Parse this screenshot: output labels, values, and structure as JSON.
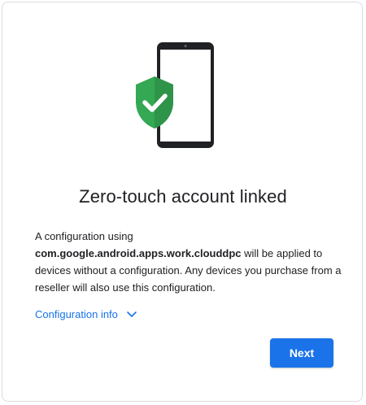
{
  "dialog": {
    "title": "Zero-touch account linked",
    "description_prefix": "A configuration using",
    "package_name": "com.google.android.apps.work.clouddpc",
    "description_suffix": " will be applied to devices without a configuration. Any devices you purchase from a reseller will also use this configuration.",
    "config_info_label": "Configuration info",
    "next_label": "Next"
  },
  "colors": {
    "accent": "#1a73e8",
    "shield": "#34a853",
    "phone_frame": "#202124"
  },
  "icons": {
    "illustration": "phone-with-shield-check-icon",
    "expand": "chevron-down-icon"
  }
}
